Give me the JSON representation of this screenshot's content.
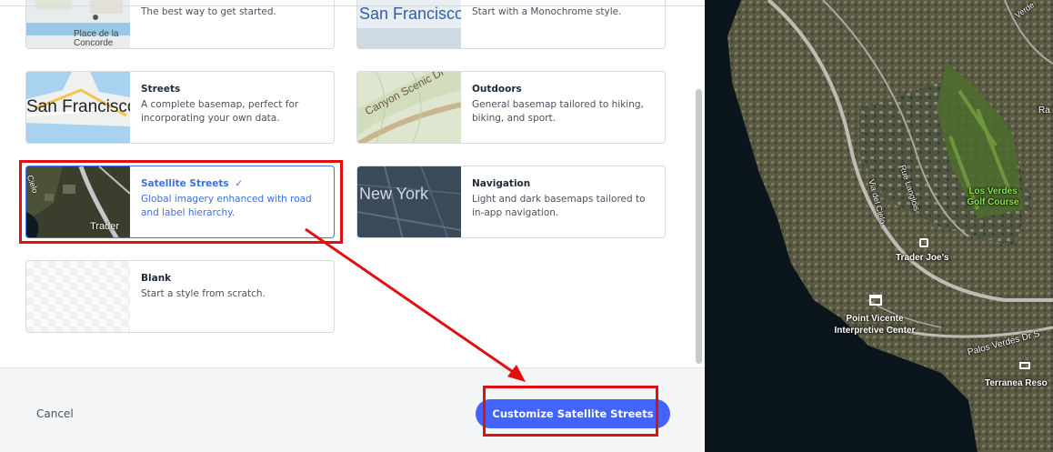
{
  "styles": [
    {
      "title": "",
      "description": "The best way to get started.",
      "thumb_label": "Place de la Concorde"
    },
    {
      "title": "",
      "description": "Start with a Monochrome style.",
      "thumb_label": "San Francisco"
    },
    {
      "title": "Streets",
      "description": "A complete basemap, perfect for incorporating your own data.",
      "thumb_label": "San Francisco"
    },
    {
      "title": "Outdoors",
      "description": "General basemap tailored to hiking, biking, and sport.",
      "thumb_label": "Canyon Scenic Dr"
    },
    {
      "title": "Satellite Streets",
      "check": "✓",
      "description": "Global imagery enhanced with road and label hierarchy.",
      "thumb_label": "Trader",
      "thumb_label2": "Cielo"
    },
    {
      "title": "Navigation",
      "description": "Light and dark basemaps tailored to in-app navigation.",
      "thumb_label": "New York"
    },
    {
      "title": "Blank",
      "description": "Start a style from scratch."
    }
  ],
  "footer": {
    "cancel_label": "Cancel",
    "cta_label": "Customize Satellite Streets"
  },
  "map": {
    "labels": {
      "golf": "Los Verdes Golf Course",
      "trader": "Trader Joe's",
      "point_vicente": "Point Vicente Interpretive Center",
      "palos": "Palos Verdes Dr S",
      "terranea": "Terranea Reso",
      "rue": "Rue Langlois",
      "cielo": "Via del Cielo",
      "verde": "Verde",
      "ra": "Ra"
    }
  },
  "colors": {
    "accent": "#4264fb",
    "selected_text": "#3d6fe0",
    "annotation_red": "#e01010"
  }
}
